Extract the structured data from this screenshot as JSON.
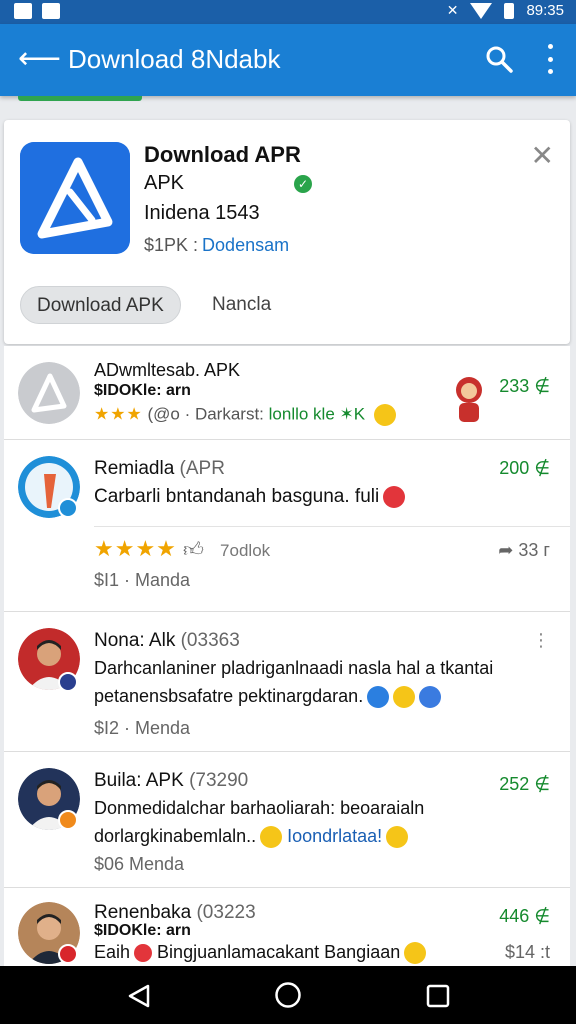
{
  "status_bar": {
    "time": "89:35"
  },
  "app_bar": {
    "title": "Download 8Ndabk"
  },
  "app_card": {
    "name": "Download APR",
    "line1": "APK",
    "line2": "Inidena 1543",
    "price": "$1PK :",
    "publisher": "Dodensam",
    "download_button": "Download APK",
    "secondary_button": "Nancla"
  },
  "reviews": [
    {
      "title": "ADwmltesab. APK",
      "line1": "$IDOKle: arn",
      "stars": "★★★",
      "meta": "(@o · Darkarst:",
      "line2": "lonllo kle ✶K",
      "count": "233 ∉"
    },
    {
      "title": "Remiadla",
      "title_dim": "(APR",
      "body": "Carbarli bntandanah basguna. fuli",
      "stars": "★★★★",
      "rating_text": "7odlok",
      "share_count": "33 г",
      "price_meta": "$I1 · Manda",
      "count": "200 ∉"
    },
    {
      "title": "Nona: Alk",
      "title_dim": "(03363",
      "body1": "Darhcanlaniner pladriganlnaadi nasla hal a tkantai",
      "body2": "petanensbsafatre pektinargdaran.",
      "price_meta": "$I2 · Menda"
    },
    {
      "title": "Buila: APK",
      "title_dim": "(73290",
      "body1": "Donmedidalchar barhaoliarah: beoaraialn",
      "body2": "dorlargkinabemlaln..",
      "link": "Ioondrlataa!",
      "price_meta": "$06 Menda",
      "count": "252 ∉"
    },
    {
      "title": "Renenbaka",
      "title_dim": "(03223",
      "line1": "$IDOKle: arn",
      "body1": "Eaih",
      "body2": "Bingjuanlamacakant Bangiaan",
      "count": "446 ∉",
      "price_right": "$14 :t"
    }
  ],
  "colors": {
    "primary": "#1a7fd4",
    "status": "#1b5fa8",
    "green": "#158a2e",
    "link": "#1a5fb4",
    "star": "#f0a400"
  }
}
